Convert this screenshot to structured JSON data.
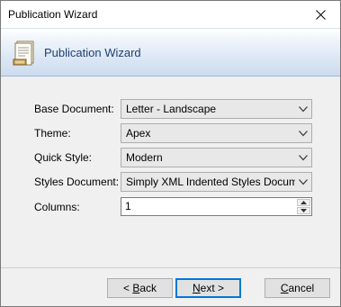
{
  "window": {
    "title": "Publication Wizard"
  },
  "banner": {
    "title": "Publication Wizard"
  },
  "form": {
    "base_document": {
      "label": "Base Document:",
      "value": "Letter - Landscape"
    },
    "theme": {
      "label": "Theme:",
      "value": "Apex"
    },
    "quick_style": {
      "label": "Quick Style:",
      "value": "Modern"
    },
    "styles_document": {
      "label": "Styles Document:",
      "value": "Simply XML Indented Styles Document"
    },
    "columns": {
      "label": "Columns:",
      "value": "1"
    }
  },
  "buttons": {
    "back": {
      "prefix": "< ",
      "mnemonic": "B",
      "rest": "ack"
    },
    "next": {
      "mnemonic": "N",
      "rest": "ext >"
    },
    "cancel": {
      "mnemonic": "C",
      "rest": "ancel"
    }
  },
  "colors": {
    "accent": "#0078d7",
    "banner_title": "#1f3f73"
  },
  "icons": [
    "close-icon",
    "document-icon",
    "chevron-down-icon",
    "spin-up-icon",
    "spin-down-icon"
  ]
}
